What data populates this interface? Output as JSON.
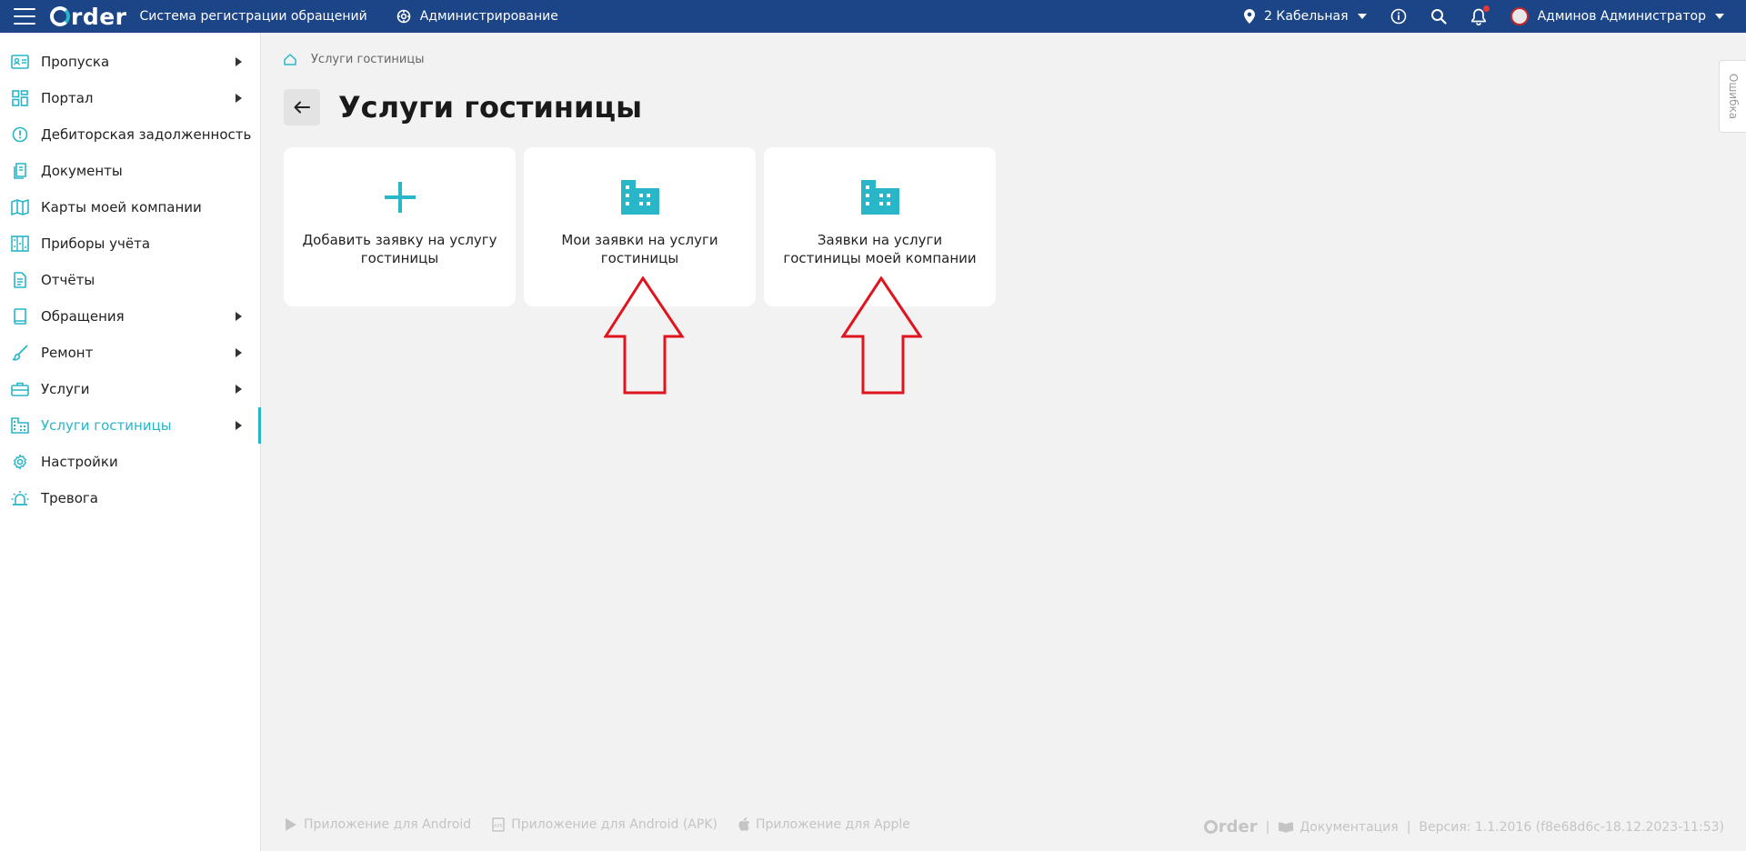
{
  "app": {
    "logo_text": "rder",
    "system_title": "Система регистрации обращений",
    "admin_label": "Администрирование"
  },
  "header": {
    "location": "2 Кабельная",
    "user_name": "Админов Администратор",
    "brand_color": "#1c4587",
    "accent_color": "#29b6c8"
  },
  "sidebar": {
    "items": [
      {
        "label": "Пропуска",
        "icon": "id-card-icon",
        "has_submenu": true
      },
      {
        "label": "Портал",
        "icon": "dashboard-icon",
        "has_submenu": true
      },
      {
        "label": "Дебиторская задолженность",
        "icon": "alert-circle-icon",
        "has_submenu": false
      },
      {
        "label": "Документы",
        "icon": "documents-icon",
        "has_submenu": false
      },
      {
        "label": "Карты моей компании",
        "icon": "map-icon",
        "has_submenu": false
      },
      {
        "label": "Приборы учёта",
        "icon": "meter-icon",
        "has_submenu": false
      },
      {
        "label": "Отчёты",
        "icon": "report-icon",
        "has_submenu": false
      },
      {
        "label": "Обращения",
        "icon": "book-icon",
        "has_submenu": true
      },
      {
        "label": "Ремонт",
        "icon": "brush-icon",
        "has_submenu": true
      },
      {
        "label": "Услуги",
        "icon": "briefcase-icon",
        "has_submenu": true
      },
      {
        "label": "Услуги гостиницы",
        "icon": "hotel-icon",
        "has_submenu": true,
        "active": true
      },
      {
        "label": "Настройки",
        "icon": "gear-icon",
        "has_submenu": false
      },
      {
        "label": "Тревога",
        "icon": "siren-icon",
        "has_submenu": false
      }
    ]
  },
  "breadcrumb": {
    "current": "Услуги гостиницы"
  },
  "page": {
    "title": "Услуги гостиницы"
  },
  "cards": [
    {
      "label": "Добавить заявку на услугу гостиницы",
      "icon": "plus-icon"
    },
    {
      "label": "Мои заявки на услуги гостиницы",
      "icon": "building-icon"
    },
    {
      "label": "Заявки на услуги гостиницы моей компании",
      "icon": "building-icon"
    }
  ],
  "side_tab": {
    "label": "Ошибка"
  },
  "footer": {
    "links": [
      {
        "label": "Приложение для Android",
        "icon": "google-play-icon"
      },
      {
        "label": "Приложение для Android (APK)",
        "icon": "apk-icon"
      },
      {
        "label": "Приложение для Apple",
        "icon": "apple-icon"
      }
    ],
    "logo_text": "rder",
    "separator": "|",
    "docs_label": "Документация",
    "version": "Версия: 1.1.2016 (f8e68d6c-18.12.2023-11:53)"
  }
}
